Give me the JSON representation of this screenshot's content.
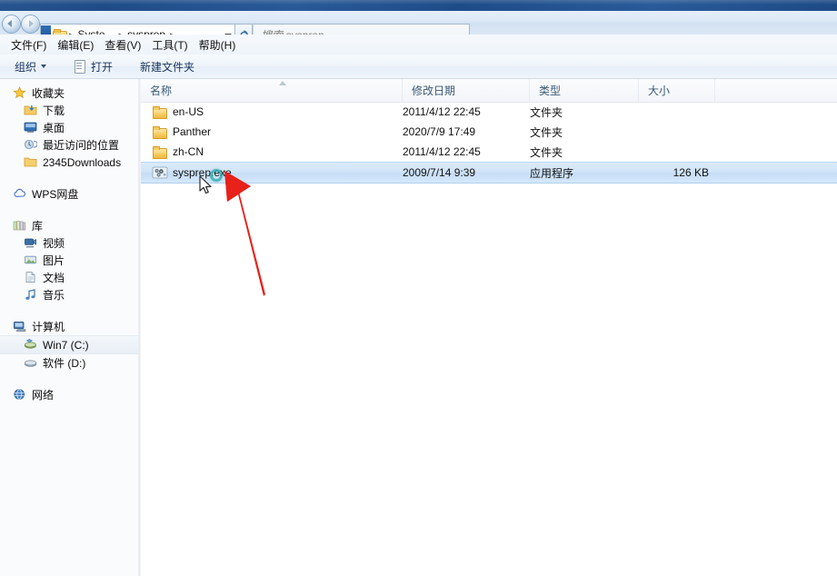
{
  "window": {
    "titlebar_color": "#23518e"
  },
  "address": {
    "back_label": "后退",
    "forward_label": "前进",
    "crumbs": [
      "Syste...",
      "sysprep"
    ],
    "leading_sep": "▸",
    "sep": "▸",
    "dropdown_label": "最近的位置",
    "refresh_label": "刷新"
  },
  "search": {
    "placeholder": "搜索 sysprep",
    "value": ""
  },
  "menubar": {
    "items": [
      {
        "label": "文件(F)",
        "name": "menu-file"
      },
      {
        "label": "编辑(E)",
        "name": "menu-edit"
      },
      {
        "label": "查看(V)",
        "name": "menu-view"
      },
      {
        "label": "工具(T)",
        "name": "menu-tools"
      },
      {
        "label": "帮助(H)",
        "name": "menu-help"
      }
    ]
  },
  "toolbar": {
    "organize_label": "组织",
    "open_label": "打开",
    "new_folder_label": "新建文件夹"
  },
  "sidebar": {
    "groups": [
      {
        "items": [
          {
            "label": "收藏夹",
            "icon": "star-icon",
            "indent": false,
            "selected": false
          },
          {
            "label": "下载",
            "icon": "download-folder-icon",
            "indent": true,
            "selected": false
          },
          {
            "label": "桌面",
            "icon": "desktop-icon",
            "indent": true,
            "selected": false
          },
          {
            "label": "最近访问的位置",
            "icon": "recent-places-icon",
            "indent": true,
            "selected": false
          },
          {
            "label": "2345Downloads",
            "icon": "folder-icon",
            "indent": true,
            "selected": false
          }
        ]
      },
      {
        "items": [
          {
            "label": "WPS网盘",
            "icon": "cloud-icon",
            "indent": false,
            "selected": false
          }
        ]
      },
      {
        "items": [
          {
            "label": "库",
            "icon": "library-icon",
            "indent": false,
            "selected": false
          },
          {
            "label": "视频",
            "icon": "video-icon",
            "indent": true,
            "selected": false
          },
          {
            "label": "图片",
            "icon": "pictures-icon",
            "indent": true,
            "selected": false
          },
          {
            "label": "文档",
            "icon": "documents-icon",
            "indent": true,
            "selected": false
          },
          {
            "label": "音乐",
            "icon": "music-icon",
            "indent": true,
            "selected": false
          }
        ]
      },
      {
        "items": [
          {
            "label": "计算机",
            "icon": "computer-icon",
            "indent": false,
            "selected": false
          },
          {
            "label": "Win7 (C:)",
            "icon": "hard-drive-system-icon",
            "indent": true,
            "selected": true
          },
          {
            "label": "软件 (D:)",
            "icon": "hard-drive-icon",
            "indent": true,
            "selected": false
          }
        ]
      },
      {
        "items": [
          {
            "label": "网络",
            "icon": "network-icon",
            "indent": false,
            "selected": false
          }
        ]
      }
    ]
  },
  "filelist": {
    "columns": [
      {
        "label": "名称",
        "name": "column-name"
      },
      {
        "label": "修改日期",
        "name": "column-date-modified"
      },
      {
        "label": "类型",
        "name": "column-type"
      },
      {
        "label": "大小",
        "name": "column-size"
      }
    ],
    "sort_column": "名称",
    "sort_direction": "asc",
    "rows": [
      {
        "name": "en-US",
        "date": "2011/4/12 22:45",
        "type": "文件夹",
        "size": "",
        "icon": "folder-icon",
        "selected": false
      },
      {
        "name": "Panther",
        "date": "2020/7/9 17:49",
        "type": "文件夹",
        "size": "",
        "icon": "folder-icon",
        "selected": false
      },
      {
        "name": "zh-CN",
        "date": "2011/4/12 22:45",
        "type": "文件夹",
        "size": "",
        "icon": "folder-icon",
        "selected": false
      },
      {
        "name": "sysprep.exe",
        "date": "2009/7/14 9:39",
        "type": "应用程序",
        "size": "126 KB",
        "icon": "sysprep-exe-icon",
        "selected": true
      }
    ]
  },
  "annotation": {
    "arrow_color": "#e8211a",
    "arrow_name": "red-pointer-arrow",
    "points_at": "sysprep.exe"
  },
  "cursor": {
    "state": "busy-working-in-background"
  }
}
